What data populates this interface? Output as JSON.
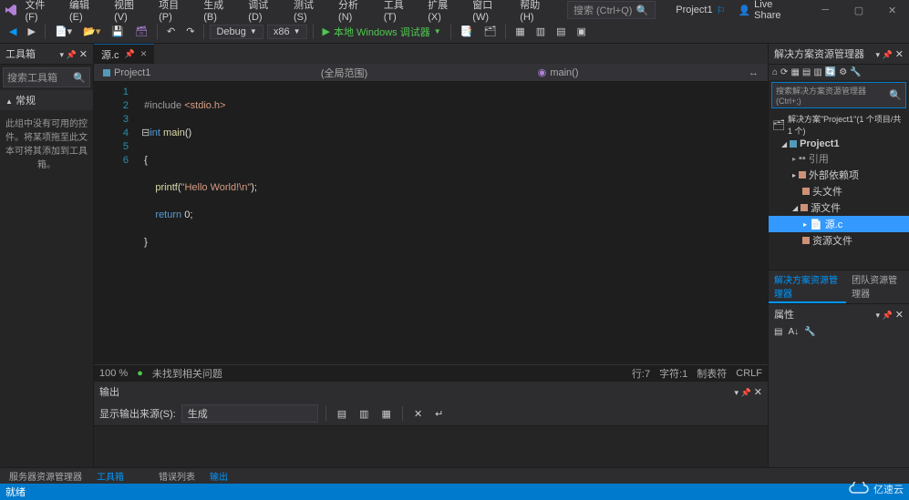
{
  "menu": {
    "file": "文件(F)",
    "edit": "编辑(E)",
    "view": "视图(V)",
    "project": "项目(P)",
    "build": "生成(B)",
    "debug": "调试(D)",
    "test": "测试(S)",
    "analyze": "分析(N)",
    "tools": "工具(T)",
    "extensions": "扩展(X)",
    "window": "窗口(W)",
    "help": "帮助(H)"
  },
  "search": {
    "placeholder": "搜索 (Ctrl+Q)"
  },
  "title": "Project1",
  "live_share": "Live Share",
  "toolbar": {
    "config": "Debug",
    "platform": "x86",
    "target": "本地 Windows 调试器"
  },
  "toolbox": {
    "title": "工具箱",
    "search": "搜索工具箱",
    "section": "常规",
    "empty": "此组中没有可用的控件。将某项拖至此文本可将其添加到工具箱。"
  },
  "tabs": {
    "file": "源.c"
  },
  "breadcrumb": {
    "project": "Project1",
    "scope": "(全局范围)",
    "symbol": "main()"
  },
  "code": {
    "lines": [
      "1",
      "2",
      "3",
      "4",
      "5",
      "6"
    ],
    "l1_pre": "#include ",
    "l1_hdr": "<stdio.h>",
    "l2_kw": "int ",
    "l2_fn": "main",
    "l2_paren": "()",
    "l3": "{",
    "l4_fn": "printf",
    "l4_open": "(",
    "l4_str": "\"Hello World!\\n\"",
    "l4_close": ");",
    "l5_kw": "return ",
    "l5_val": "0",
    "l5_semi": ";",
    "l6": "}"
  },
  "editor_status": {
    "zoom": "100 %",
    "issues": "未找到相关问题",
    "line": "行:7",
    "col": "字符:1",
    "tabs": "制表符",
    "eol": "CRLF"
  },
  "output": {
    "title": "输出",
    "source_label": "显示输出来源(S):",
    "source": "生成"
  },
  "solution": {
    "title": "解决方案资源管理器",
    "search": "搜索解决方案资源管理器(Ctrl+;)",
    "root": "解决方案\"Project1\"(1 个项目/共 1 个)",
    "project": "Project1",
    "refs": "引用",
    "external": "外部依赖项",
    "headers": "头文件",
    "sources": "源文件",
    "file": "源.c",
    "resources": "资源文件",
    "tab1": "解决方案资源管理器",
    "tab2": "团队资源管理器"
  },
  "properties": {
    "title": "属性"
  },
  "bottom_tabs": {
    "server": "服务器资源管理器",
    "toolbox": "工具箱",
    "errors": "错误列表",
    "out": "输出"
  },
  "status": {
    "ready": "就绪"
  },
  "watermark": "亿速云"
}
